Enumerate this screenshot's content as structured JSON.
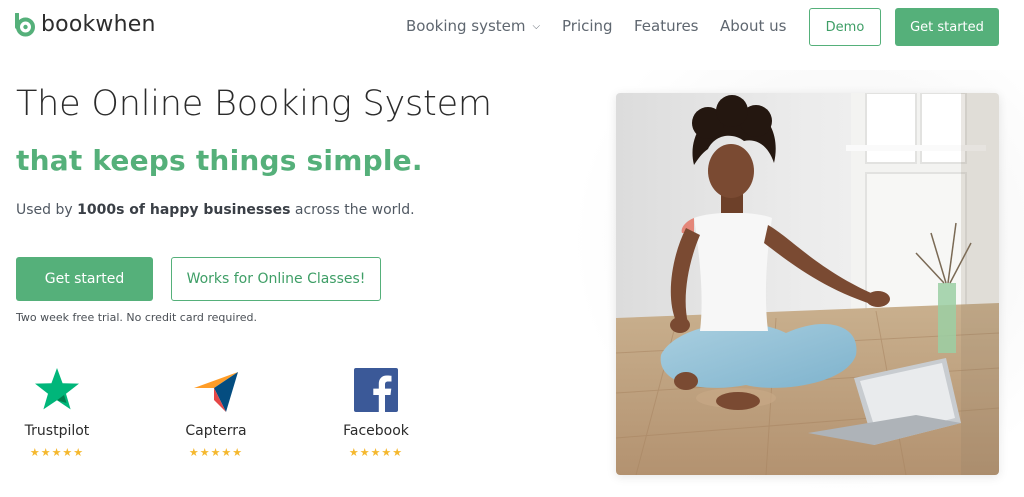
{
  "brand": {
    "name": "bookwhen",
    "accent": "#55b07a"
  },
  "nav": {
    "booking_system": "Booking system",
    "pricing": "Pricing",
    "features": "Features",
    "about_us": "About us",
    "demo": "Demo",
    "get_started": "Get started"
  },
  "hero": {
    "title": "The Online Booking System",
    "subtitle": "that keeps things simple.",
    "desc_prefix": "Used by ",
    "desc_bold": "1000s of happy businesses",
    "desc_suffix": " across the world.",
    "cta_primary": "Get started",
    "cta_secondary": "Works for Online Classes!",
    "trial_note": "Two week free trial. No credit card required."
  },
  "reviews": [
    {
      "name": "Trustpilot",
      "stars": "★★★★★",
      "icon": "trustpilot-star-icon",
      "rating": 5
    },
    {
      "name": "Capterra",
      "stars": "★★★★★",
      "icon": "capterra-icon",
      "rating": 5
    },
    {
      "name": "Facebook",
      "stars": "★★★★★",
      "icon": "facebook-icon",
      "rating": 5
    }
  ],
  "colors": {
    "star": "#f5b82e",
    "trustpilot": "#00b67a",
    "facebook": "#3b5998"
  }
}
